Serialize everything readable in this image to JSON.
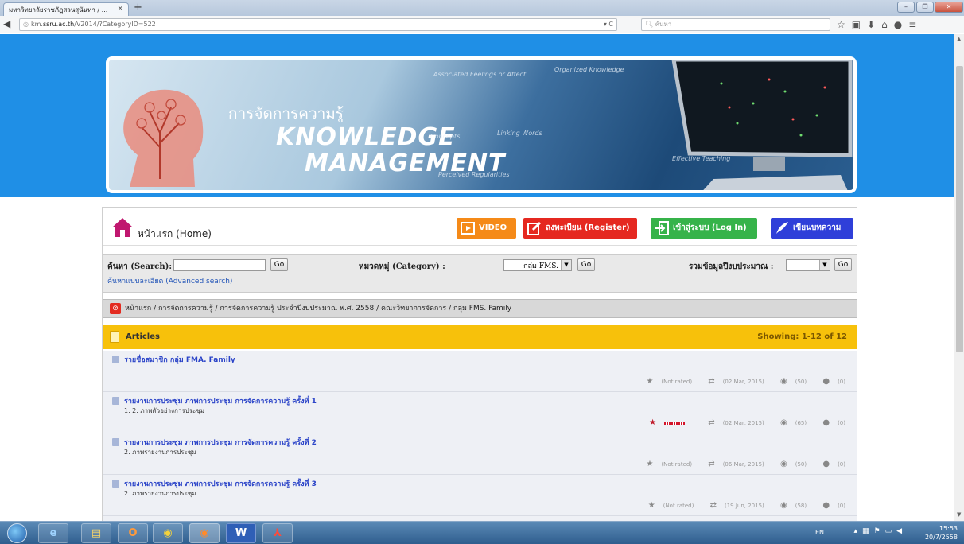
{
  "browser": {
    "tab_title": "มหาวิทยาลัยราชภัฏสวนสุนันทา / ...",
    "tab_close": "×",
    "new_tab": "+",
    "url_prefix": "km.",
    "url_host": "ssru.ac.th",
    "url_path": "/V2014/?CategoryID=522",
    "search_placeholder": "ค้นหา",
    "window_controls": [
      "–",
      "❐",
      "✕"
    ]
  },
  "banner": {
    "thai_title": "การจัดการความรู้",
    "title_line1": "KNOWLEDGE",
    "title_line2": "MANAGEMENT",
    "diagram_labels": [
      "Associated Feelings or Affect",
      "Organized Knowledge",
      "Concepts",
      "Linking Words",
      "Effective Teaching",
      "Perceived Regularities"
    ]
  },
  "topnav": {
    "home_label": "หน้าแรก (Home)",
    "video_label": "VIDEO",
    "register_label": "ลงทะเบียน (Register)",
    "login_label": "เข้าสู่ระบบ (Log In)",
    "write_label": "เขียนบทความ",
    "colors": {
      "video": "#f58a18",
      "register": "#e52820",
      "login": "#36b34a",
      "write": "#2f3fd9"
    }
  },
  "search": {
    "search_label": "ค้นหา (Search):",
    "search_value": "",
    "go_label": "Go",
    "advanced_label": "ค้นหาแบบละเอียด (Advanced search)",
    "category_label": "หมวดหมู่ (Category) :",
    "category_value": "– – – กลุ่ม FMS. Fa",
    "budget_label": "รวมข้อมูลปีงบประมาณ :",
    "budget_value": ""
  },
  "breadcrumb": "หน้าแรก / การจัดการความรู้ / การจัดการความรู้ ประจำปีงบประมาณ พ.ศ. 2558 / คณะวิทยาการจัดการ / กลุ่ม FMS. Family",
  "articles": {
    "header": "Articles",
    "showing": "Showing: 1-12 of 12",
    "items": [
      {
        "title": "รายชื่อสมาชิก กลุ่ม FMA. Family",
        "desc": "",
        "rating": "(Not rated)",
        "date": "(02 Mar, 2015)",
        "views": "(50)",
        "comments": "(0)"
      },
      {
        "title": "รายงานการประชุม ภาพการประชุม การจัดการความรู้ ครั้งที่ 1",
        "desc": "1. 2. ภาพตัวอย่างการประชุม",
        "rating": "",
        "date": "(02 Mar, 2015)",
        "views": "(65)",
        "comments": "(0)"
      },
      {
        "title": "รายงานการประชุม ภาพการประชุม การจัดการความรู้ ครั้งที่ 2",
        "desc": "2. ภาพรายงานการประชุม",
        "rating": "(Not rated)",
        "date": "(06 Mar, 2015)",
        "views": "(50)",
        "comments": "(0)"
      },
      {
        "title": "รายงานการประชุม ภาพการประชุม การจัดการความรู้ ครั้งที่ 3",
        "desc": "2. ภาพรายงานการประชุม",
        "rating": "(Not rated)",
        "date": "(19 Jun, 2015)",
        "views": "(58)",
        "comments": "(0)"
      }
    ]
  },
  "taskbar": {
    "apps": [
      "e",
      "▤",
      "O",
      "◉",
      "◉",
      "W",
      "⅄"
    ],
    "lang": "EN",
    "time": "15:53",
    "date": "20/7/2558"
  }
}
